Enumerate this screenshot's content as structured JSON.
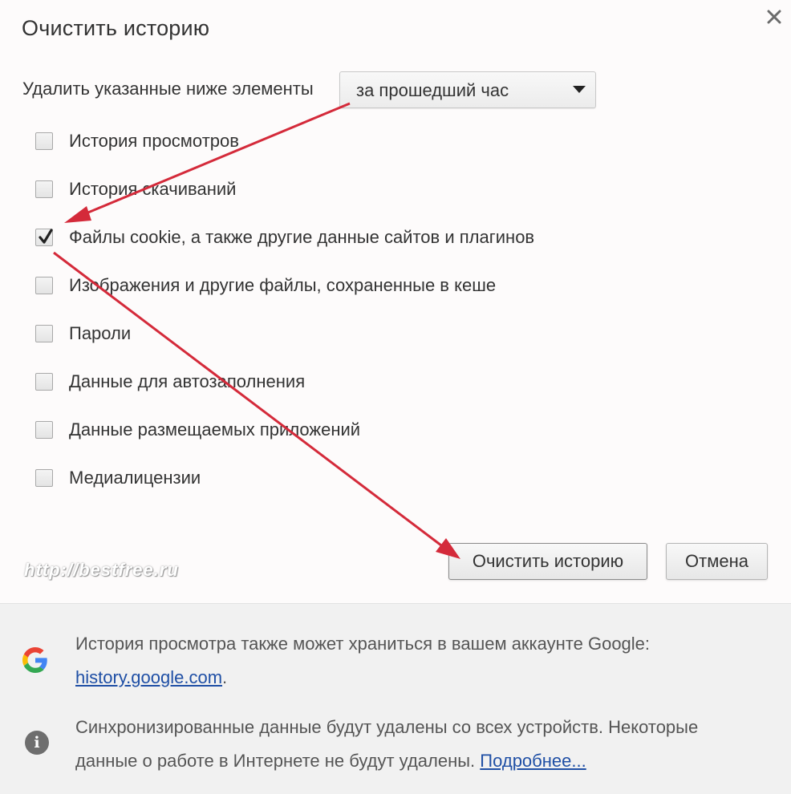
{
  "dialog": {
    "title": "Очистить историю",
    "period_label": "Удалить указанные ниже элементы",
    "period_select": {
      "value": "за прошедший час",
      "icon": "dropdown-caret-icon"
    },
    "options": [
      {
        "label": "История просмотров",
        "checked": false
      },
      {
        "label": "История скачиваний",
        "checked": false
      },
      {
        "label": "Файлы cookie, а также другие данные сайтов и плагинов",
        "checked": true
      },
      {
        "label": "Изображения и другие файлы, сохраненные в кеше",
        "checked": false
      },
      {
        "label": "Пароли",
        "checked": false
      },
      {
        "label": "Данные для автозаполнения",
        "checked": false
      },
      {
        "label": "Данные размещаемых приложений",
        "checked": false
      },
      {
        "label": "Медиалицензии",
        "checked": false
      }
    ],
    "buttons": {
      "clear": "Очистить историю",
      "cancel": "Отмена"
    },
    "close_icon": "close-icon"
  },
  "watermark": "http://bestfree.ru",
  "footer": {
    "google_note_text": "История просмотра также может храниться в вашем аккаунте Google:",
    "google_note_link": "history.google.com",
    "google_note_suffix": ".",
    "sync_note_text_line1": "Синхронизированные данные будут удалены со всех устройств. Некоторые",
    "sync_note_text_line2": "данные о работе в Интернете не будут удалены.",
    "sync_note_link": "Подробнее..."
  },
  "colors": {
    "annotation_arrow": "#d42a3a",
    "link": "#1f4fa5",
    "footer_bg": "#f1f1f1"
  }
}
